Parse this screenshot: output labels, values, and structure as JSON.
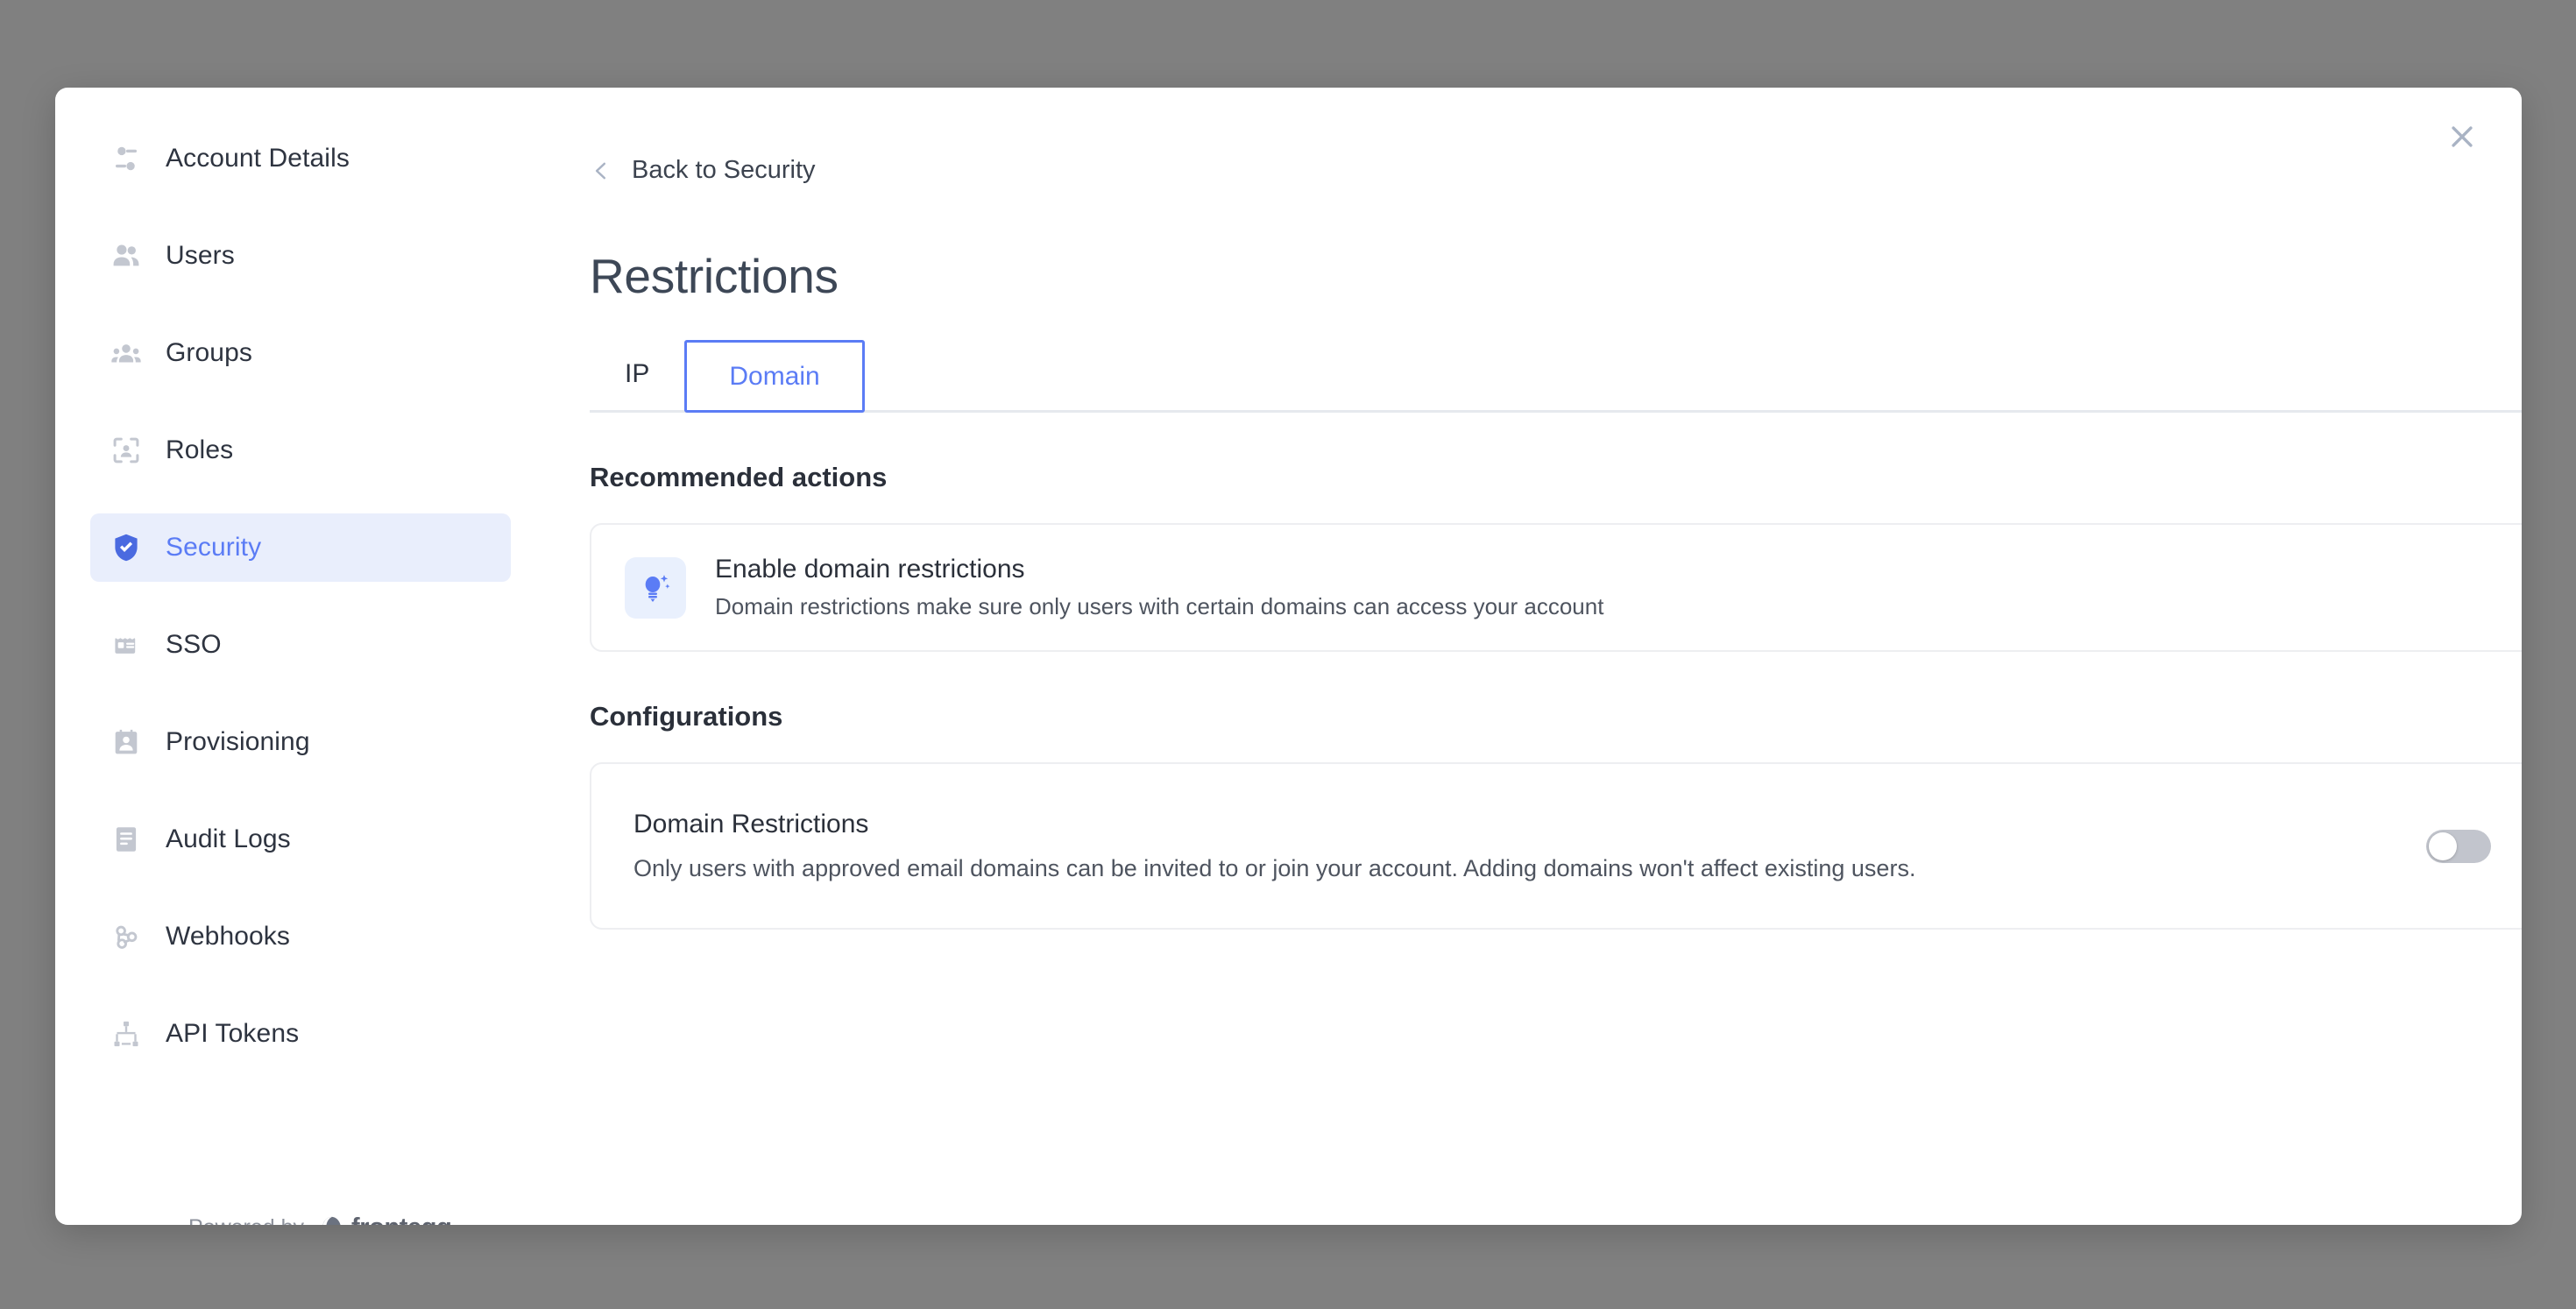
{
  "modal": {
    "close_icon": "close-icon"
  },
  "sidebar": {
    "items": [
      {
        "label": "Account Details",
        "icon": "sliders-icon",
        "active": false
      },
      {
        "label": "Users",
        "icon": "users-icon",
        "active": false
      },
      {
        "label": "Groups",
        "icon": "groups-icon",
        "active": false
      },
      {
        "label": "Roles",
        "icon": "roles-scan-icon",
        "active": false
      },
      {
        "label": "Security",
        "icon": "shield-check-icon",
        "active": true
      },
      {
        "label": "SSO",
        "icon": "sso-card-icon",
        "active": false
      },
      {
        "label": "Provisioning",
        "icon": "provisioning-badge-icon",
        "active": false
      },
      {
        "label": "Audit Logs",
        "icon": "document-lines-icon",
        "active": false
      },
      {
        "label": "Webhooks",
        "icon": "webhook-icon",
        "active": false
      },
      {
        "label": "API Tokens",
        "icon": "hierarchy-icon",
        "active": false
      }
    ],
    "footer": {
      "powered_by": "Powered by",
      "brand": "frontegg"
    }
  },
  "main": {
    "back_link": {
      "label": "Back to Security",
      "icon": "chevron-left-icon"
    },
    "title": "Restrictions",
    "tabs": [
      {
        "label": "IP",
        "selected": false
      },
      {
        "label": "Domain",
        "selected": true
      }
    ],
    "recommended": {
      "section_title": "Recommended actions",
      "items": [
        {
          "icon": "lightbulb-sparkle-icon",
          "title": "Enable domain restrictions",
          "description": "Domain restrictions make sure only users with certain domains can access your account"
        }
      ]
    },
    "configurations": {
      "section_title": "Configurations",
      "items": [
        {
          "title": "Domain Restrictions",
          "description": "Only users with approved email domains can be invited to or join your account. Adding domains won't affect existing users.",
          "toggle_on": false
        }
      ]
    }
  },
  "colors": {
    "accent_blue": "#5b7cf5",
    "active_nav_bg": "#e9eefc",
    "icon_gray": "#c3c7d0",
    "backdrop": "#808080",
    "toggle_off": "#c2c5cd"
  }
}
